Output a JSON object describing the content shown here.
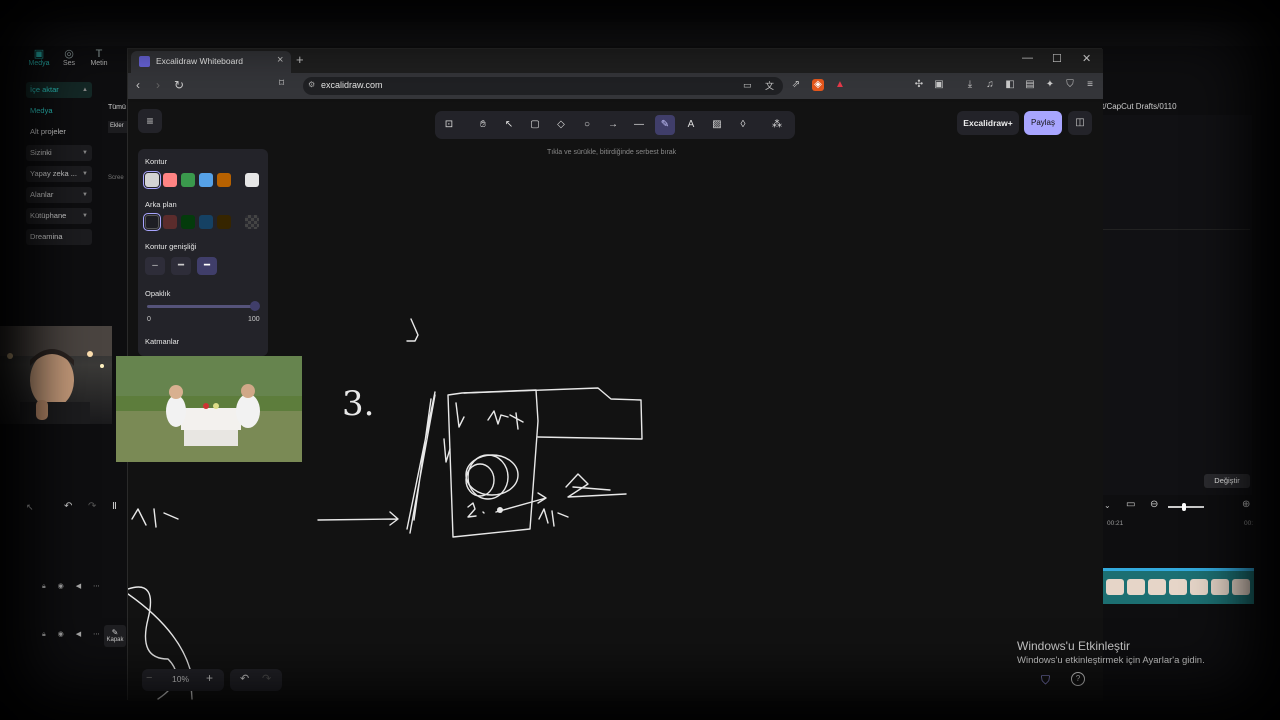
{
  "capcut": {
    "tabs": [
      {
        "label": "Medya",
        "icon": "media-icon"
      },
      {
        "label": "Ses",
        "icon": "audio-icon"
      },
      {
        "label": "Metin",
        "icon": "text-icon"
      }
    ],
    "sidebar": [
      {
        "label": "İçe aktar"
      },
      {
        "label": "Medya"
      },
      {
        "label": "Alt projeler"
      },
      {
        "label": "Sizinki"
      },
      {
        "label": "Yapay zeka ..."
      },
      {
        "label": "Alanlar"
      },
      {
        "label": "Kütüphane"
      },
      {
        "label": "Dreamina"
      }
    ],
    "all_label": "Tümü",
    "add_label": "Ekler",
    "screen_label": "Scree",
    "right_path": "t/CapCut Drafts/0110",
    "change_button": "Değiştir",
    "timeline_start": "00:21",
    "timeline_end": "00:",
    "cover_label": "Kapak"
  },
  "browser": {
    "tab_title": "Excalidraw Whiteboard",
    "url": "excalidraw.com"
  },
  "excalidraw": {
    "hint": "Tıkla ve sürükle, bitirdiğinde serbest bırak",
    "plus_label": "Excalidraw+",
    "share_label": "Paylaş",
    "props": {
      "stroke_label": "Kontur",
      "background_label": "Arka plan",
      "stroke_width_label": "Kontur genişliği",
      "opacity_label": "Opaklık",
      "opacity_min": "0",
      "opacity_max": "100",
      "opacity_value": 100,
      "layers_label": "Katmanlar",
      "stroke_colors": [
        "#d3d3d3",
        "#ff8383",
        "#3a994c",
        "#56a2e8",
        "#b76100",
        "#e6e6e6"
      ],
      "background_colors": [
        "transparent",
        "#5b2c2c",
        "#043b0c",
        "#154163",
        "#362500",
        "checker"
      ]
    },
    "zoom": "10%",
    "drawing_text": "3."
  },
  "windows": {
    "activate_title": "Windows'u Etkinleştir",
    "activate_sub": "Windows'u etkinleştirmek için Ayarlar'a gidin."
  }
}
